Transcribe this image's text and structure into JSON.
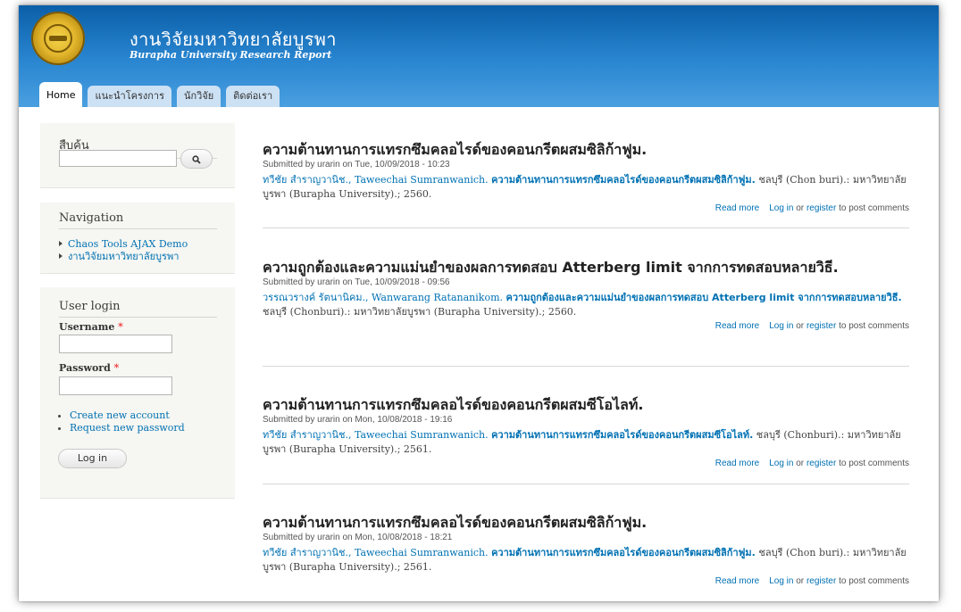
{
  "site": {
    "name": "งานวิจัยมหาวิทยาลัยบูรพา",
    "slogan": "Burapha University Research Report"
  },
  "tabs": [
    {
      "label": "Home",
      "active": true
    },
    {
      "label": "แนะนำโครงการ",
      "active": false
    },
    {
      "label": "นักวิจัย",
      "active": false
    },
    {
      "label": "ติดต่อเรา",
      "active": false
    }
  ],
  "search": {
    "title": "สืบค้น",
    "value": "",
    "button_icon": "search-icon"
  },
  "navigation": {
    "title": "Navigation",
    "items": [
      "Chaos Tools AJAX Demo",
      "งานวิจัยมหาวิทยาลัยบูรพา"
    ]
  },
  "login": {
    "title": "User login",
    "username_label": "Username",
    "password_label": "Password",
    "required_mark": "*",
    "username_value": "",
    "password_value": "",
    "links": [
      "Create new account",
      "Request new password"
    ],
    "button": "Log in"
  },
  "node_links": {
    "read_more": "Read more",
    "log_in": "Log in",
    "or": "or",
    "register": "register",
    "suffix": "to post comments"
  },
  "nodes": [
    {
      "title": "ความต้านทานการแทรกซึมคลอไรด์ของคอนกรีตผสมซิลิก้าฟูม.",
      "submitted": "Submitted by urarin on Tue, 10/09/2018 - 10:23",
      "authors": "ทวีชัย สำราญวานิช., Taweechai Sumranwanich.",
      "body_title": "ความต้านทานการแทรกซึมคลอไรด์ของคอนกรีตผสมซิลิก้าฟูม.",
      "publisher": "ชลบุรี (Chon buri).: มหาวิทยาลัยบูรพา (Burapha University).; 2560."
    },
    {
      "title": "ความถูกต้องและความแม่นยำของผลการทดสอบ Atterberg limit จากการทดสอบหลายวิธี.",
      "submitted": "Submitted by urarin on Tue, 10/09/2018 - 09:56",
      "authors": "วรรณวรางค์ รัตนานิคม., Wanwarang Ratananikom.",
      "body_title": "ความถูกต้องและความแม่นยำของผลการทดสอบ Atterberg limit จากการทดสอบหลายวิธี.",
      "publisher": "ชลบุรี (Chonburi).: มหาวิทยาลัยบูรพา (Burapha University).; 2560."
    },
    {
      "title": "ความต้านทานการแทรกซึมคลอไรด์ของคอนกรีตผสมซีโอไลท์.",
      "submitted": "Submitted by urarin on Mon, 10/08/2018 - 19:16",
      "authors": "ทวีชัย สำราญวานิช., Taweechai Sumranwanich.",
      "body_title": "ความต้านทานการแทรกซึมคลอไรด์ของคอนกรีตผสมซีโอไลท์.",
      "publisher": "ชลบุรี (Chonburi).: มหาวิทยาลัยบูรพา (Burapha University).; 2561."
    },
    {
      "title": "ความต้านทานการแทรกซึมคลอไรด์ของคอนกรีตผสมซิลิก้าฟูม.",
      "submitted": "Submitted by urarin on Mon, 10/08/2018 - 18:21",
      "authors": "ทวีชัย สำราญวานิช., Taweechai Sumranwanich.",
      "body_title": "ความต้านทานการแทรกซึมคลอไรด์ของคอนกรีตผสมซิลิก้าฟูม.",
      "publisher": "ชลบุรี (Chon buri).: มหาวิทยาลัยบูรพา (Burapha University).; 2561."
    }
  ]
}
